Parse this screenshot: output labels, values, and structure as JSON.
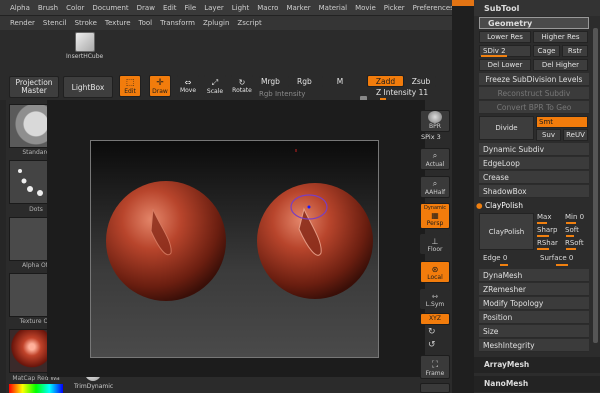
{
  "menu_row1": [
    "Alpha",
    "Brush",
    "Color",
    "Document",
    "Draw",
    "Edit",
    "File",
    "Layer",
    "Light",
    "Macro",
    "Marker",
    "Material",
    "Movie",
    "Picker",
    "Preferences"
  ],
  "menu_row2": [
    "Render",
    "Stencil",
    "Stroke",
    "Texture",
    "Tool",
    "Transform",
    "Zplugin",
    "Zscript"
  ],
  "insert_cube_label": "InsertHCube",
  "toolbar": {
    "projection_master": "Projection Master",
    "lightbox": "LightBox",
    "edit": "Edit",
    "draw": "Draw",
    "move": "Move",
    "scale": "Scale",
    "rotate": "Rotate",
    "mrgb": "Mrgb",
    "rgb": "Rgb",
    "m": "M",
    "zadd": "Zadd",
    "zsub": "Zsub",
    "rgb_intensity": "Rgb Intensity",
    "z_intensity_label": "Z Intensity",
    "z_intensity_value": "11"
  },
  "left_shelf": {
    "standard": "Standard",
    "dots": "Dots",
    "alpha_off": "Alpha Off",
    "texture_off": "Texture Off",
    "matcap": "MatCap Red Wa",
    "trim_dynamic": "TrimDynamic"
  },
  "right_tools": {
    "bpr": "BPR",
    "spix_label": "SPix",
    "spix_value": "3",
    "actual": "Actual",
    "aahalf": "AAHalf",
    "dynamic": "Dynamic",
    "persp": "Persp",
    "floor": "Floor",
    "local": "Local",
    "lsym": "L.Sym",
    "xyz": "XYZ",
    "frame": "Frame"
  },
  "subtool": {
    "title": "SubTool",
    "geometry": "Geometry",
    "lower_res": "Lower Res",
    "higher_res": "Higher Res",
    "sdiv_label": "SDiv",
    "sdiv_value": "2",
    "cage": "Cage",
    "rstr": "Rstr",
    "del_lower": "Del Lower",
    "del_higher": "Del Higher",
    "freeze": "Freeze SubDivision Levels",
    "reconstruct": "Reconstruct Subdiv",
    "convert_bpr": "Convert BPR To Geo",
    "divide": "Divide",
    "smt": "Smt",
    "suv": "Suv",
    "reuv": "ReUV",
    "dynamic_subdiv": "Dynamic Subdiv",
    "edgeloop": "EdgeLoop",
    "crease": "Crease",
    "shadowbox": "ShadowBox",
    "claypolish_header": "ClayPolish",
    "claypolish_btn": "ClayPolish",
    "max_label": "Max",
    "min_label": "Min",
    "min_value": "0",
    "sharp": "Sharp",
    "soft": "Soft",
    "rshar": "RShar",
    "rsoft": "RSoft",
    "edge_label": "Edge",
    "edge_value": "0",
    "surface_label": "Surface",
    "surface_value": "0",
    "dynamesh": "DynaMesh",
    "zremesher": "ZRemesher",
    "modify_topology": "Modify Topology",
    "position": "Position",
    "size": "Size",
    "meshintegrity": "MeshIntegrity",
    "arraymesh": "ArrayMesh",
    "nanomesh": "NanoMesh"
  }
}
